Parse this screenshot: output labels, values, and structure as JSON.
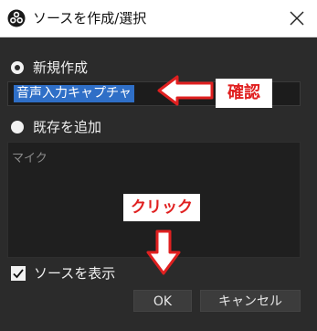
{
  "window": {
    "title": "ソースを作成/選択"
  },
  "create_new": {
    "label": "新規作成",
    "selected": true,
    "name_value": "音声入力キャプチャ"
  },
  "add_existing": {
    "label": "既存を追加",
    "selected": false,
    "items": [
      "マイク"
    ]
  },
  "show_source": {
    "label": "ソースを表示",
    "checked": true
  },
  "buttons": {
    "ok": "OK",
    "cancel": "キャンセル"
  },
  "annotations": {
    "confirm": "確認",
    "click": "クリック"
  },
  "colors": {
    "dialog_bg": "#2b2b2b",
    "selection": "#2f6fc7",
    "annotation_red": "#e02020"
  }
}
